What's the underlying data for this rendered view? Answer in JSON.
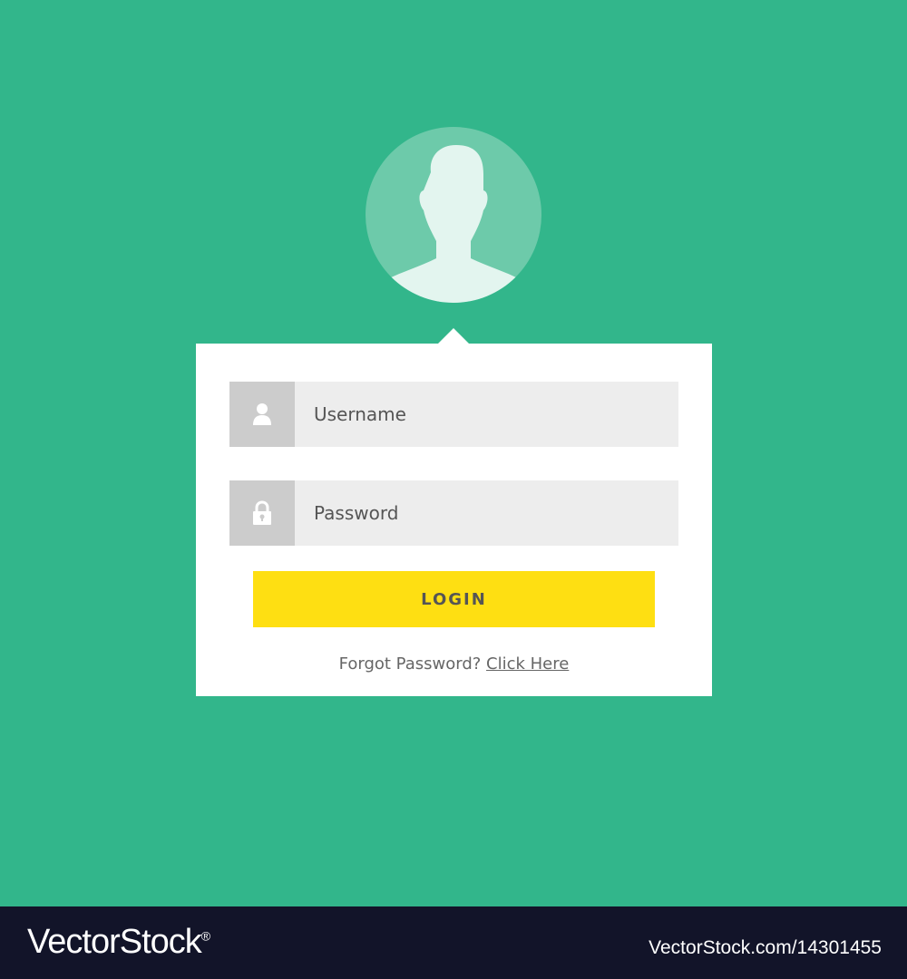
{
  "colors": {
    "background": "#32b68b",
    "avatar_ring": "#6dcaaa",
    "avatar_silhouette": "#e3f5ef",
    "card": "#ffffff",
    "field_bg": "#ededed",
    "field_icon_bg": "#cccccc",
    "button": "#fedf12",
    "text": "#555555",
    "footer": "#121429"
  },
  "avatar": {
    "icon": "user-silhouette-icon"
  },
  "form": {
    "username": {
      "placeholder": "Username",
      "value": "",
      "icon": "user-icon"
    },
    "password": {
      "placeholder": "Password",
      "value": "",
      "icon": "lock-icon"
    },
    "login_label": "LOGIN",
    "forgot_text": "Forgot Password?",
    "forgot_link": "Click Here"
  },
  "footer": {
    "logo_text": "VectorStock",
    "logo_mark": "®",
    "image_id": "VectorStock.com/14301455"
  }
}
